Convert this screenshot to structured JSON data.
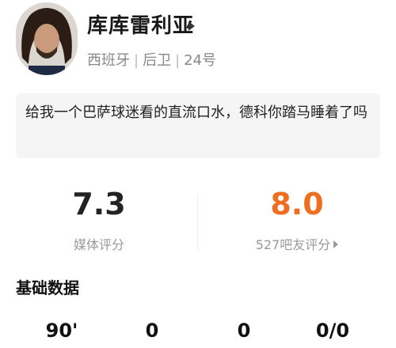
{
  "player": {
    "name": "库库雷利亚",
    "country": "西班牙",
    "position": "后卫",
    "number": "24号",
    "separator": "|"
  },
  "comment": {
    "text": "给我一个巴萨球迷看的直流口水，德科你踏马睡着了吗"
  },
  "ratings": {
    "media": {
      "value": "7.3",
      "label": "媒体评分"
    },
    "fans": {
      "value": "8.0",
      "label": "527吧友评分"
    },
    "accent_color": "#ef6d1f"
  },
  "basic_data": {
    "title": "基础数据",
    "stats": [
      "90'",
      "0",
      "0",
      "0/0"
    ]
  },
  "icons": {
    "name_arrow": "triangle-right-icon",
    "rating_arrow": "triangle-right-small-icon"
  }
}
